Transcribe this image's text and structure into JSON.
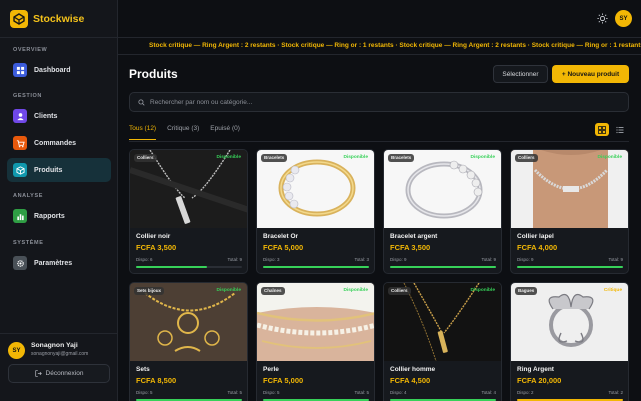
{
  "app": {
    "name": "Stockwise"
  },
  "sidebar": {
    "sections": [
      "OVERVIEW",
      "GESTION",
      "ANALYSE",
      "SYSTÈME"
    ],
    "items": [
      {
        "label": "Dashboard",
        "icon": "dashboard-icon",
        "color": "#3b5bdb"
      },
      {
        "label": "Clients",
        "icon": "users-icon",
        "color": "#7048e8"
      },
      {
        "label": "Commandes",
        "icon": "cart-icon",
        "color": "#e8590c"
      },
      {
        "label": "Produits",
        "icon": "box-icon",
        "color": "#1098ad"
      },
      {
        "label": "Rapports",
        "icon": "chart-icon",
        "color": "#2f9e44"
      },
      {
        "label": "Paramètres",
        "icon": "gear-icon",
        "color": "#495057"
      }
    ],
    "user": {
      "initials": "SY",
      "name": "Sonagnon Yaji",
      "email": "sonagnonyaji@gmail.com"
    },
    "logout_label": "Déconnexion"
  },
  "topbar": {
    "avatar_initials": "SY",
    "theme_icon": "sun-icon"
  },
  "ticker": {
    "text": "Stock critique — Ring Argent : 2 restants · Stock critique — Ring or : 1 restants · Stock critique — Ring Argent : 2 restants · Stock critique — Ring or : 1 restants"
  },
  "page": {
    "title": "Produits",
    "select_label": "Sélectionner",
    "new_label": "+ Nouveau produit",
    "search_placeholder": "Rechercher par nom ou catégorie...",
    "tabs": [
      "Tous (12)",
      "Critique (3)",
      "Epuisé (0)"
    ]
  },
  "colors": {
    "accent": "#f2b705",
    "available": "#37d159",
    "critical": "#f2b705"
  },
  "products": [
    {
      "category": "Colliers",
      "status": "Disponible",
      "name": "Collier noir",
      "price": "FCFA 3,500",
      "dispo": "Dispo: 6",
      "total": "Total: 9",
      "stock_ratio": 0.67,
      "img": "necklace-dark"
    },
    {
      "category": "Bracelets",
      "status": "Disponible",
      "name": "Bracelet Or",
      "price": "FCFA 5,000",
      "dispo": "Dispo: 3",
      "total": "Total: 3",
      "stock_ratio": 1.0,
      "img": "bracelet-gold"
    },
    {
      "category": "Bracelets",
      "status": "Disponible",
      "name": "Bracelet argent",
      "price": "FCFA 3,500",
      "dispo": "Dispo: 9",
      "total": "Total: 9",
      "stock_ratio": 1.0,
      "img": "bracelet-silver"
    },
    {
      "category": "Colliers",
      "status": "Disponible",
      "name": "Collier lapel",
      "price": "FCFA 4,000",
      "dispo": "Dispo: 9",
      "total": "Total: 9",
      "stock_ratio": 1.0,
      "img": "necklace-skin"
    },
    {
      "category": "Sets bijoux",
      "status": "Disponible",
      "name": "Sets",
      "price": "FCFA 8,500",
      "dispo": "Dispo: 5",
      "total": "Total: 5",
      "stock_ratio": 1.0,
      "img": "set-gold"
    },
    {
      "category": "Chaînes",
      "status": "Disponible",
      "name": "Perle",
      "price": "FCFA 5,000",
      "dispo": "Dispo: 5",
      "total": "Total: 5",
      "stock_ratio": 1.0,
      "img": "shell-chain"
    },
    {
      "category": "Colliers",
      "status": "Disponible",
      "name": "Collier homme",
      "price": "FCFA 4,500",
      "dispo": "Dispo: 4",
      "total": "Total: 4",
      "stock_ratio": 1.0,
      "img": "chain-gold-dark"
    },
    {
      "category": "Bagues",
      "status": "Critique",
      "name": "Ring Argent",
      "price": "FCFA 20,000",
      "dispo": "Dispo: 2",
      "total": "Total: 2",
      "stock_ratio": 1.0,
      "img": "ring-silver"
    }
  ]
}
